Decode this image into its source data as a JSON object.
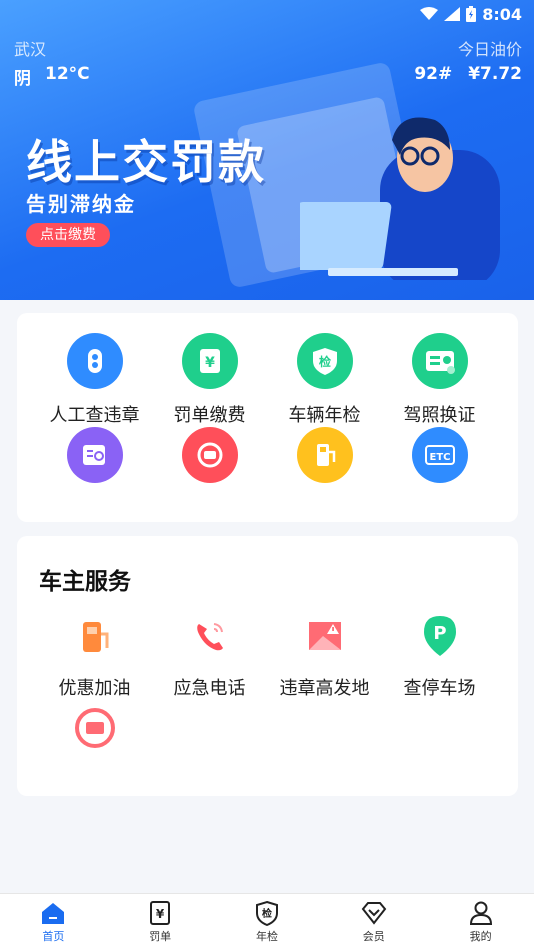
{
  "status_bar": {
    "time": "8:04"
  },
  "header": {
    "city": "武汉",
    "weather": "阴",
    "temperature": "12°C",
    "oil_title": "今日油价",
    "oil_grade": "92#",
    "oil_price": "¥7.72"
  },
  "banner": {
    "title": "线上交罚款",
    "subtitle": "告别滞纳金",
    "button": "点击缴费"
  },
  "quick_services": {
    "items": [
      {
        "label": "人工查违章",
        "icon": "magnifier-icon",
        "color": "#2f8cff"
      },
      {
        "label": "罚单缴费",
        "icon": "yuan-bill-icon",
        "color": "#1fcf8c"
      },
      {
        "label": "车辆年检",
        "icon": "inspection-shield-icon",
        "color": "#1fcf8c"
      },
      {
        "label": "驾照换证",
        "icon": "license-card-icon",
        "color": "#1fcf8c"
      },
      {
        "label": "",
        "icon": "report-search-icon",
        "color": "#8a62f5"
      },
      {
        "label": "",
        "icon": "card-circle-icon",
        "color": "#ff4f5a"
      },
      {
        "label": "",
        "icon": "fuel-pump-icon",
        "color": "#ffc11e"
      },
      {
        "label": "",
        "icon": "etc-icon",
        "color": "#2f8cff",
        "text": "ETC"
      }
    ]
  },
  "owner_services": {
    "title": "车主服务",
    "items": [
      {
        "label": "优惠加油",
        "icon": "fuel-pump-icon",
        "color": "#ff8a3c"
      },
      {
        "label": "应急电话",
        "icon": "phone-icon",
        "color": "#ff4f5a"
      },
      {
        "label": "违章高发地",
        "icon": "warning-map-icon",
        "color": "#ff4f5a"
      },
      {
        "label": "查停车场",
        "icon": "parking-pin-icon",
        "color": "#1fcf8c"
      },
      {
        "label": "",
        "icon": "card-circle-icon",
        "color": "#ff4f5a"
      }
    ]
  },
  "tabbar": {
    "items": [
      {
        "label": "首页",
        "icon": "home-icon",
        "active": true
      },
      {
        "label": "罚单",
        "icon": "yuan-bill-icon"
      },
      {
        "label": "年检",
        "icon": "inspection-shield-icon"
      },
      {
        "label": "会员",
        "icon": "diamond-icon"
      },
      {
        "label": "我的",
        "icon": "user-icon"
      }
    ]
  },
  "colors": {
    "primary": "#1a6cf0",
    "accent": "#ff4f5a"
  }
}
